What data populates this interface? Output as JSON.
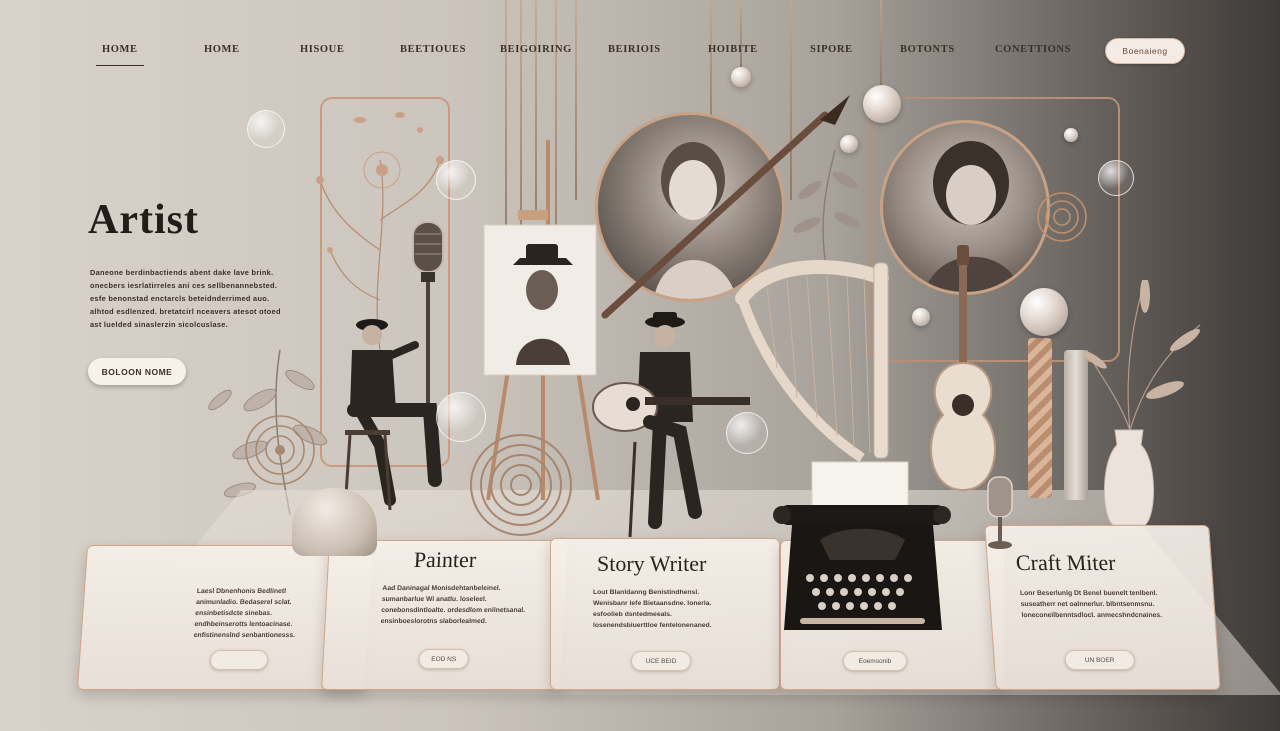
{
  "nav": {
    "items": [
      {
        "label": "HOME",
        "active": true
      },
      {
        "label": "HOME",
        "active": false
      },
      {
        "label": "HISOUE",
        "active": false
      },
      {
        "label": "BEETIOUES",
        "active": false
      },
      {
        "label": "BEIGOIRING",
        "active": false
      },
      {
        "label": "BEIRIOIS",
        "active": false
      },
      {
        "label": "HOIBITE",
        "active": false
      },
      {
        "label": "SIPORE",
        "active": false
      },
      {
        "label": "BOTONTS",
        "active": false
      },
      {
        "label": "CONETTIONS",
        "active": false
      }
    ],
    "cta_label": "Boenaieng"
  },
  "hero": {
    "title": "Artist",
    "text": "Daneone berdinbactiends abent dake lave brink. onecbers iesrlatirreles ani ces sellbenannebsted. esfe benonstad enctarcls beteidnderrimed auo. alhtod esdlenzed. bretatcirl nceavers atesot otoed ast luelded sinaslerzin sicolcuslase.",
    "button_label": "BOLOON NOME"
  },
  "cards": [
    {
      "title": "",
      "text": "Laesl Dbnenhonis Bedlinetl animunladio. Bedaserel sclat. ensinbetisdcte sinebas. endhbeinserotts lentoacinase. enfistinenslnd senbantionesss.",
      "button_label": ""
    },
    {
      "title": "Painter",
      "text": "Aad Daninagal Monisdehtanbeleinel. sumanbarlue Wi anatlu. loseleel. conebonsdintloalte. ordesdlom enilnetsanal. ensinboeslorotns slaborlealmed.",
      "button_label": "EOD NS"
    },
    {
      "title": "Story Writer",
      "text": "Lout Blanldanng Benistindhensl. Wenisbanr lefe Bietaansdne. lonerla. esfoolieb dsntedmeeals. losenendsbiuerttloe fentelonenaned.",
      "button_label": "UCE BEID"
    },
    {
      "title": "",
      "text": "",
      "button_label": "Eoemsonib"
    },
    {
      "title": "Craft Miter",
      "text": "Lonr Beserlunlg Dt Benel buenelt tenlbenl. suseatherr net oalnnerlur. blbntsenmsnu. loneconeilbenntsdlocl. anmecshndcnaines.",
      "button_label": "UN BOER"
    }
  ],
  "colors": {
    "accent": "#c99a7d",
    "text_dark": "#231c18",
    "background_light": "#d8d2cb",
    "background_dark": "#3e3a37"
  }
}
